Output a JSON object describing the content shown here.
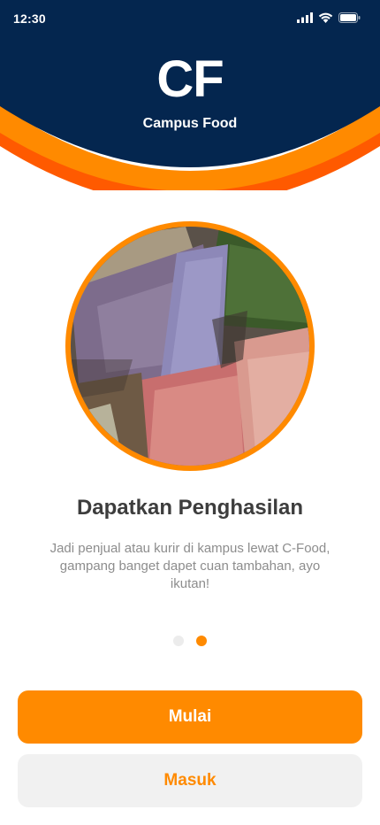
{
  "status_bar": {
    "time": "12:30",
    "icons": [
      "signal-icon",
      "wifi-icon",
      "battery-icon"
    ]
  },
  "header": {
    "logo_text": "CF",
    "brand_name": "Campus Food"
  },
  "onboarding": {
    "image_alt": "money-photo",
    "title": "Dapatkan Penghasilan",
    "description": "Jadi penjual atau kurir di kampus lewat C-Food, gampang banget dapet cuan tambahan, ayo ikutan!",
    "page_indicator": {
      "total": 2,
      "active_index": 1
    }
  },
  "actions": {
    "primary_label": "Mulai",
    "secondary_label": "Masuk"
  },
  "colors": {
    "navy": "#04264f",
    "orange": "#ff8a00",
    "deep_orange": "#ff5a00",
    "title_text": "#3d3d3d",
    "body_text": "#8d8d8d"
  }
}
